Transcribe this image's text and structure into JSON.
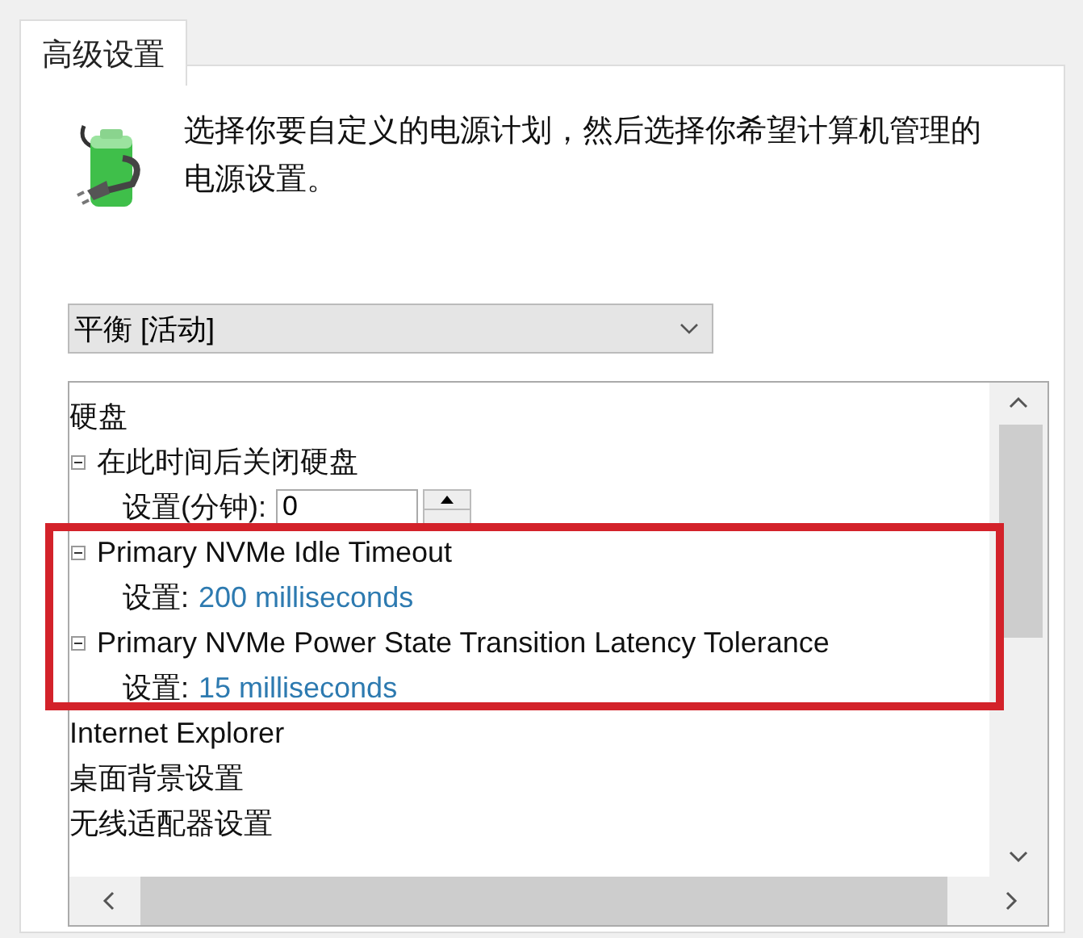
{
  "tabs": [
    {
      "label": "高级设置",
      "selected": true
    }
  ],
  "description": "选择你要自定义的电源计划，然后选择你希望计算机管理的电源设置。",
  "plan_dropdown": {
    "value": "平衡 [活动]"
  },
  "tree": [
    {
      "label": "硬盘",
      "kind": "group",
      "children": [
        {
          "label": "在此时间后关闭硬盘",
          "kind": "node",
          "expanded": true,
          "children": [
            {
              "kind": "spinner",
              "label": "设置(分钟):",
              "value": "0"
            }
          ]
        },
        {
          "label": "Primary NVMe Idle Timeout",
          "kind": "node",
          "expanded": true,
          "children": [
            {
              "kind": "value",
              "label": "设置:",
              "value": "200 milliseconds"
            }
          ]
        },
        {
          "label": "Primary NVMe Power State Transition Latency Tolerance",
          "kind": "node",
          "expanded": true,
          "children": [
            {
              "kind": "value",
              "label": "设置:",
              "value": "15 milliseconds"
            }
          ]
        }
      ]
    },
    {
      "label": "Internet Explorer",
      "kind": "group"
    },
    {
      "label": "桌面背景设置",
      "kind": "group"
    },
    {
      "label": "无线适配器设置",
      "kind": "group"
    }
  ],
  "highlight": {
    "color": "#d3222a"
  }
}
